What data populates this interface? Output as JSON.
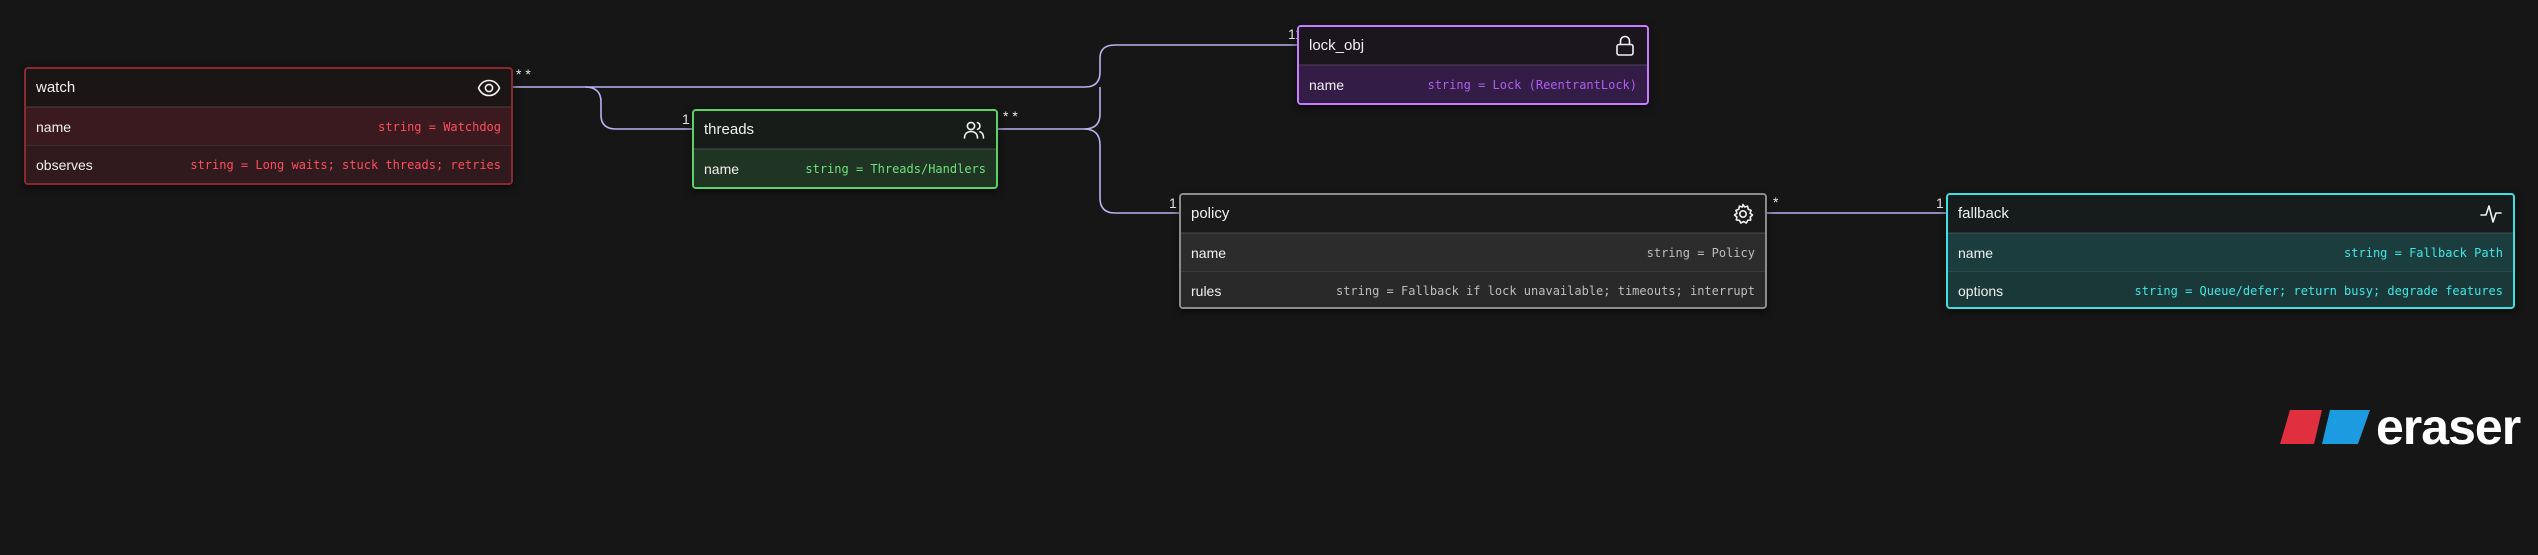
{
  "entities": {
    "watch": {
      "title": "watch",
      "icon": "eye-icon",
      "color": "#e63946",
      "fields": [
        {
          "name": "name",
          "type": "string = Watchdog"
        },
        {
          "name": "observes",
          "type": "string = Long waits; stuck threads; retries"
        }
      ]
    },
    "threads": {
      "title": "threads",
      "icon": "users-icon",
      "color": "#5ad26a",
      "fields": [
        {
          "name": "name",
          "type": "string = Threads/Handlers"
        }
      ]
    },
    "lock_obj": {
      "title": "lock_obj",
      "icon": "lock-icon",
      "color": "#b45ae6",
      "fields": [
        {
          "name": "name",
          "type": "string = Lock (ReentrantLock)"
        }
      ]
    },
    "policy": {
      "title": "policy",
      "icon": "gear-icon",
      "color": "#9a9a9a",
      "fields": [
        {
          "name": "name",
          "type": "string = Policy"
        },
        {
          "name": "rules",
          "type": "string = Fallback if lock unavailable; timeouts; interrupt"
        }
      ]
    },
    "fallback": {
      "title": "fallback",
      "icon": "activity-icon",
      "color": "#3ee0e0",
      "fields": [
        {
          "name": "name",
          "type": "string = Fallback Path"
        },
        {
          "name": "options",
          "type": "string = Queue/defer; return busy; degrade features"
        }
      ]
    }
  },
  "relations": [
    {
      "from": "watch",
      "to": "lock_obj",
      "from_card": "* *",
      "to_card": "1"
    },
    {
      "from": "watch",
      "to": "threads",
      "from_card": "",
      "to_card": "1"
    },
    {
      "from": "threads",
      "to": "lock_obj",
      "from_card": "* *",
      "to_card": "1"
    },
    {
      "from": "threads",
      "to": "policy",
      "from_card": "",
      "to_card": "1"
    },
    {
      "from": "policy",
      "to": "fallback",
      "from_card": "*",
      "to_card": "1"
    }
  ],
  "brand": {
    "name": "eraser",
    "colors": [
      "#e0303f",
      "#1d9be0"
    ]
  }
}
